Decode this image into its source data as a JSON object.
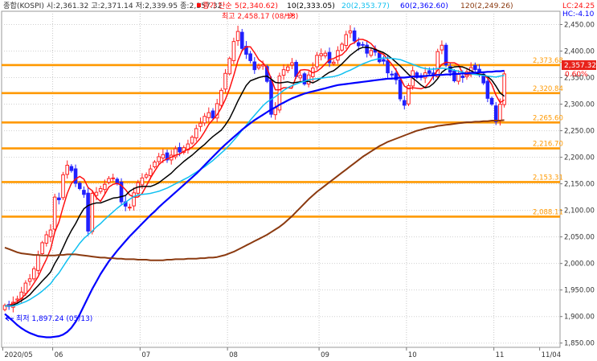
{
  "header": {
    "ohlc": "종합(KOSPI) 시:2,361.32 고:2,371.14 저:2,339.95 종:2,357.32",
    "ma_title": "종가 단순",
    "ma_items": [
      {
        "label": "5(2,340.62)",
        "color": "#ff1010"
      },
      {
        "label": "10(2,333.05)",
        "color": "#000000"
      },
      {
        "label": "20(2,353.77)",
        "color": "#10c0f0"
      },
      {
        "label": "60(2,362.60)",
        "color": "#0000ff"
      },
      {
        "label": "120(2,249.26)",
        "color": "#8b3a10"
      }
    ],
    "lc": "LC:24.25",
    "hc": "HC:-4.10"
  },
  "price_tag": {
    "value": "2,357.32",
    "change": "0.60%"
  },
  "annotations": {
    "high": "최고 2,458.17 (08/13)",
    "low": "최저 1,897.24 (05/13)"
  },
  "chart_data": {
    "type": "candlestick",
    "ylim": [
      1842,
      2475
    ],
    "y_ticks": [
      1850,
      1900,
      1950,
      2000,
      2050,
      2100,
      2150,
      2200,
      2250,
      2300,
      2350,
      2400,
      2450
    ],
    "y_tick_labels": [
      "1,850.00",
      "1,900.00",
      "1,950.00",
      "2,000.00",
      "2,050.00",
      "2,100.00",
      "2,150.00",
      "2,200.00",
      "2,250.00",
      "2,300.00",
      "2,350.00",
      "2,400.00",
      "2,450.00"
    ],
    "x_labels": [
      "2020/05",
      "06",
      "07",
      "08",
      "09",
      "10",
      "11",
      "11/04"
    ],
    "x_label_bar_index": [
      0,
      12,
      33,
      54,
      76,
      97,
      118,
      129
    ],
    "levels": [
      {
        "value": 2373.68,
        "label": "2,373.68"
      },
      {
        "value": 2320.84,
        "label": "2,320.84"
      },
      {
        "value": 2265.6,
        "label": "2,265.60"
      },
      {
        "value": 2216.7,
        "label": "2,216.70"
      },
      {
        "value": 2153.31,
        "label": "2,153.31"
      },
      {
        "value": 2088.11,
        "label": "2,088.11"
      }
    ],
    "level_color": "#ff9900",
    "closes": [
      1921,
      1919,
      1927,
      1933,
      1946,
      1963,
      1971,
      1990,
      2016,
      2039,
      2054,
      2063,
      2125,
      2120,
      2167,
      2185,
      2175,
      2151,
      2141,
      2130,
      2061,
      2132,
      2134,
      2141,
      2149,
      2160,
      2161,
      2150,
      2116,
      2108,
      2106,
      2133,
      2152,
      2161,
      2167,
      2178,
      2191,
      2201,
      2205,
      2195,
      2204,
      2216,
      2210,
      2218,
      2225,
      2238,
      2254,
      2264,
      2277,
      2284,
      2274,
      2301,
      2326,
      2358,
      2386,
      2418,
      2437,
      2405,
      2394,
      2382,
      2365,
      2372,
      2374,
      2343,
      2281,
      2293,
      2353,
      2365,
      2370,
      2378,
      2352,
      2354,
      2338,
      2355,
      2368,
      2392,
      2395,
      2396,
      2378,
      2379,
      2401,
      2413,
      2431,
      2438,
      2419,
      2410,
      2412,
      2396,
      2401,
      2398,
      2380,
      2381,
      2359,
      2355,
      2346,
      2310,
      2298,
      2335,
      2363,
      2350,
      2351,
      2359,
      2358,
      2354,
      2399,
      2411,
      2374,
      2360,
      2344,
      2357,
      2350,
      2361,
      2369,
      2365,
      2359,
      2340,
      2311,
      2300,
      2267,
      2300,
      2357
    ],
    "series": [
      {
        "name": "5",
        "color": "#ff1010",
        "values": [
          1920,
          1921,
          1925,
          1928,
          1934,
          1942,
          1951,
          1963,
          1975,
          1992,
          2008,
          2027,
          2059,
          2078,
          2106,
          2132,
          2151,
          2159,
          2164,
          2159,
          2143,
          2137,
          2124,
          2117,
          2130,
          2144,
          2149,
          2151,
          2147,
          2139,
          2129,
          2125,
          2125,
          2132,
          2146,
          2161,
          2174,
          2186,
          2193,
          2197,
          2200,
          2204,
          2206,
          2211,
          2215,
          2219,
          2227,
          2236,
          2248,
          2262,
          2271,
          2280,
          2293,
          2309,
          2329,
          2354,
          2382,
          2401,
          2408,
          2408,
          2397,
          2384,
          2378,
          2368,
          2348,
          2327,
          2327,
          2331,
          2331,
          2330,
          2352,
          2364,
          2365,
          2364,
          2359,
          2362,
          2368,
          2376,
          2384,
          2386,
          2390,
          2393,
          2401,
          2412,
          2416,
          2422,
          2422,
          2419,
          2414,
          2405,
          2397,
          2394,
          2384,
          2375,
          2364,
          2350,
          2334,
          2329,
          2331,
          2330,
          2329,
          2332,
          2341,
          2353,
          2364,
          2375,
          2379,
          2378,
          2378,
          2374,
          2358,
          2355,
          2356,
          2358,
          2357,
          2355,
          2349,
          2337,
          2317,
          2303,
          2308
        ]
      },
      {
        "name": "10",
        "color": "#000000",
        "values": [
          1920,
          1920,
          1922,
          1925,
          1930,
          1935,
          1941,
          1950,
          1958,
          1967,
          1975,
          1984,
          2000,
          2013,
          2030,
          2047,
          2062,
          2075,
          2090,
          2103,
          2109,
          2112,
          2114,
          2114,
          2117,
          2120,
          2123,
          2124,
          2126,
          2128,
          2136,
          2141,
          2144,
          2145,
          2145,
          2145,
          2148,
          2152,
          2158,
          2164,
          2170,
          2178,
          2185,
          2192,
          2198,
          2204,
          2211,
          2218,
          2224,
          2232,
          2239,
          2245,
          2251,
          2261,
          2273,
          2289,
          2306,
          2321,
          2335,
          2344,
          2347,
          2350,
          2352,
          2353,
          2347,
          2341,
          2340,
          2341,
          2342,
          2340,
          2341,
          2342,
          2343,
          2343,
          2340,
          2344,
          2349,
          2355,
          2360,
          2363,
          2369,
          2376,
          2384,
          2392,
          2398,
          2404,
          2407,
          2407,
          2406,
          2403,
          2400,
          2397,
          2392,
          2386,
          2379,
          2372,
          2364,
          2356,
          2349,
          2343,
          2336,
          2331,
          2333,
          2339,
          2348,
          2360,
          2366,
          2368,
          2370,
          2371,
          2370,
          2367,
          2363,
          2359,
          2356,
          2356,
          2352,
          2345,
          2334,
          2321,
          2315
        ]
      },
      {
        "name": "20",
        "color": "#10c0f0",
        "values": [
          1920,
          1920,
          1920,
          1922,
          1925,
          1928,
          1932,
          1937,
          1942,
          1948,
          1955,
          1962,
          1973,
          1982,
          1994,
          2006,
          2017,
          2027,
          2038,
          2047,
          2054,
          2061,
          2069,
          2075,
          2083,
          2090,
          2097,
          2104,
          2110,
          2115,
          2121,
          2126,
          2129,
          2130,
          2131,
          2132,
          2134,
          2136,
          2139,
          2142,
          2146,
          2150,
          2154,
          2158,
          2162,
          2167,
          2172,
          2177,
          2182,
          2188,
          2194,
          2201,
          2208,
          2215,
          2223,
          2232,
          2241,
          2251,
          2260,
          2270,
          2279,
          2288,
          2297,
          2304,
          2309,
          2314,
          2320,
          2326,
          2331,
          2335,
          2338,
          2341,
          2343,
          2346,
          2347,
          2348,
          2349,
          2350,
          2351,
          2352,
          2354,
          2357,
          2361,
          2364,
          2368,
          2372,
          2376,
          2379,
          2382,
          2384,
          2386,
          2387,
          2387,
          2386,
          2385,
          2384,
          2381,
          2378,
          2375,
          2372,
          2369,
          2367,
          2366,
          2366,
          2367,
          2368,
          2367,
          2366,
          2364,
          2362,
          2360,
          2358,
          2357,
          2356,
          2355,
          2354,
          2353,
          2352,
          2351,
          2353,
          2354
        ]
      },
      {
        "name": "60",
        "color": "#0000ff",
        "values": [
          1905,
          1898,
          1891,
          1884,
          1878,
          1873,
          1869,
          1866,
          1863,
          1862,
          1861,
          1861,
          1862,
          1863,
          1866,
          1871,
          1879,
          1890,
          1904,
          1920,
          1936,
          1952,
          1966,
          1980,
          1992,
          2004,
          2014,
          2024,
          2033,
          2042,
          2051,
          2059,
          2067,
          2075,
          2083,
          2091,
          2098,
          2106,
          2113,
          2120,
          2127,
          2134,
          2141,
          2148,
          2155,
          2162,
          2169,
          2177,
          2185,
          2193,
          2201,
          2209,
          2217,
          2224,
          2231,
          2238,
          2245,
          2252,
          2258,
          2264,
          2270,
          2275,
          2280,
          2285,
          2290,
          2294,
          2299,
          2303,
          2307,
          2311,
          2314,
          2317,
          2320,
          2322,
          2324,
          2326,
          2328,
          2330,
          2332,
          2334,
          2336,
          2337,
          2338,
          2339,
          2340,
          2341,
          2342,
          2343,
          2344,
          2345,
          2346,
          2347,
          2348,
          2348,
          2349,
          2350,
          2350,
          2351,
          2352,
          2352,
          2353,
          2353,
          2354,
          2354,
          2355,
          2355,
          2356,
          2356,
          2357,
          2357,
          2358,
          2358,
          2359,
          2359,
          2360,
          2360,
          2361,
          2361,
          2362,
          2362,
          2363
        ]
      },
      {
        "name": "120",
        "color": "#8b3a10",
        "values": [
          2030,
          2027,
          2024,
          2021,
          2019,
          2018,
          2017,
          2016,
          2016,
          2015,
          2015,
          2015,
          2015,
          2016,
          2016,
          2017,
          2017,
          2017,
          2016,
          2015,
          2014,
          2013,
          2012,
          2011,
          2011,
          2010,
          2010,
          2009,
          2009,
          2008,
          2008,
          2008,
          2007,
          2007,
          2007,
          2006,
          2006,
          2006,
          2006,
          2007,
          2007,
          2008,
          2008,
          2008,
          2009,
          2009,
          2009,
          2010,
          2010,
          2011,
          2011,
          2012,
          2014,
          2016,
          2019,
          2022,
          2026,
          2030,
          2034,
          2038,
          2042,
          2046,
          2050,
          2054,
          2059,
          2064,
          2069,
          2075,
          2082,
          2089,
          2097,
          2105,
          2113,
          2121,
          2128,
          2135,
          2141,
          2147,
          2153,
          2159,
          2165,
          2171,
          2177,
          2183,
          2189,
          2195,
          2201,
          2206,
          2211,
          2216,
          2221,
          2225,
          2229,
          2232,
          2235,
          2238,
          2241,
          2244,
          2247,
          2250,
          2252,
          2254,
          2256,
          2257,
          2259,
          2260,
          2261,
          2262,
          2263,
          2264,
          2265,
          2266,
          2266,
          2267,
          2267,
          2268,
          2268,
          2269,
          2269,
          2269,
          2270
        ]
      }
    ]
  }
}
